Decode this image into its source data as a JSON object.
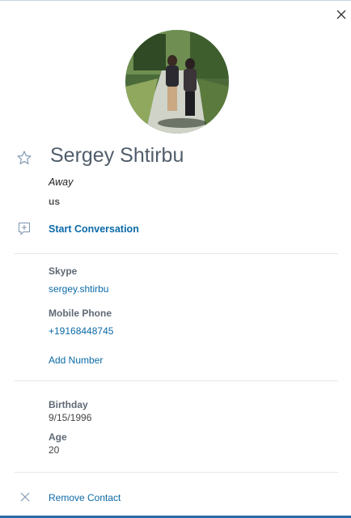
{
  "contact": {
    "name": "Sergey Shtirbu",
    "presence": "Away",
    "location": "us"
  },
  "actions": {
    "start_conversation": "Start Conversation",
    "remove_contact": "Remove Contact"
  },
  "details": {
    "skype_label": "Skype",
    "skype_value": "sergey.shtirbu",
    "mobile_label": "Mobile Phone",
    "mobile_value": "+19168448745",
    "add_number": "Add Number",
    "birthday_label": "Birthday",
    "birthday_value": "9/15/1996",
    "age_label": "Age",
    "age_value": "20"
  },
  "icons": {
    "close": "close-icon",
    "favorite": "star-outline-icon",
    "conversation": "add-conversation-icon",
    "remove": "remove-x-icon"
  },
  "colors": {
    "link": "#0b6aa7",
    "name": "#515d6b",
    "label": "#5f6975",
    "divider": "#e3e6ea",
    "bottom_bar": "#2b6aa8"
  }
}
